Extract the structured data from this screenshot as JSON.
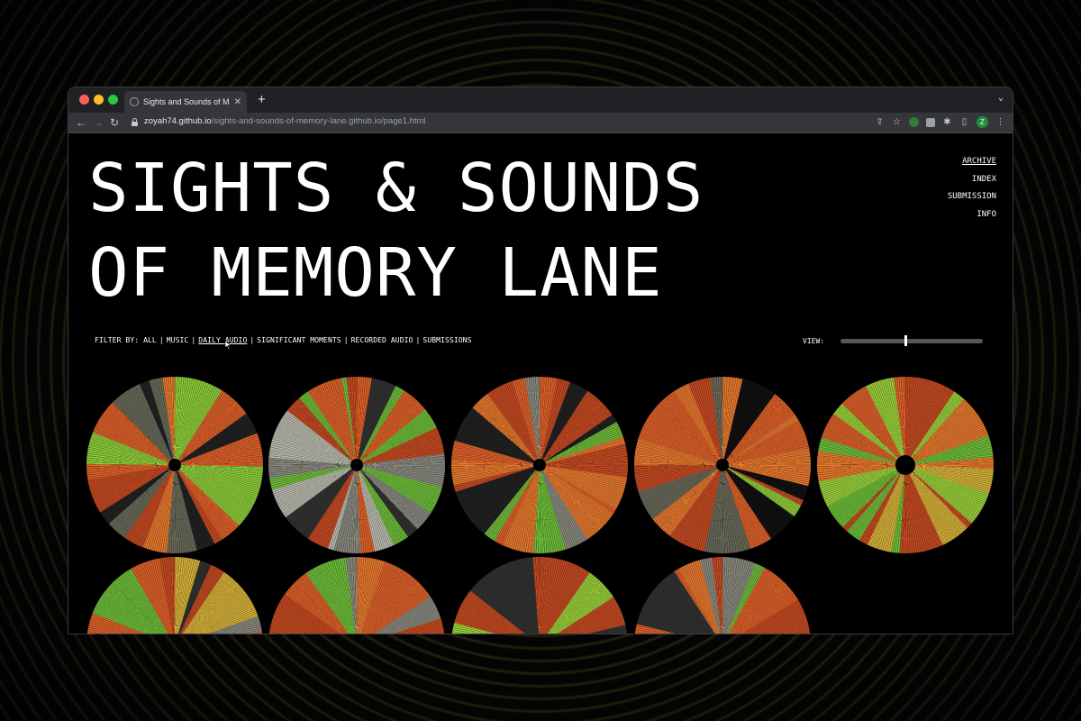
{
  "browser": {
    "tab_title": "Sights and Sounds of Memory Lane",
    "tab_close": "✕",
    "new_tab": "+",
    "tab_menu": "⌄",
    "url_host": "zoyah74.github.io",
    "url_path": "/sights-and-sounds-of-memory-lane.github.io/page1.html",
    "profile_initial": "Z",
    "nav": {
      "back": "←",
      "forward": "→",
      "reload": "↻"
    },
    "icons": {
      "share": "⇪",
      "star": "☆",
      "puzzle": "✱",
      "sidebar": "▯",
      "menu": "⋮"
    }
  },
  "site": {
    "title_line1": "SIGHTS & SOUNDS",
    "title_line2": "OF MEMORY LANE"
  },
  "side_nav": [
    {
      "label": "ARCHIVE",
      "active": true
    },
    {
      "label": "INDEX"
    },
    {
      "label": "SUBMISSION"
    },
    {
      "label": "INFO"
    }
  ],
  "filter": {
    "prefix": "FILTER BY:",
    "separator": "|",
    "items": [
      {
        "label": "ALL"
      },
      {
        "label": "MUSIC"
      },
      {
        "label": "DAILY AUDIO",
        "active": true
      },
      {
        "label": "SIGNIFICANT MOMENTS"
      },
      {
        "label": "RECORDED AUDIO"
      },
      {
        "label": "SUBMISSIONS"
      }
    ]
  },
  "view": {
    "label": "VIEW:",
    "slider_value": 0.45
  },
  "colors": {
    "orange": "#e3662c",
    "red_orange": "#d24a25",
    "green": "#6fbf3a",
    "lime": "#9bd23b",
    "gray": "#6a6a5a",
    "dark": "#1a1a1a",
    "yellow": "#d8b33a"
  },
  "archive_items": [
    {
      "palette": [
        "#e0622a",
        "#c84b22",
        "#8fcf3a",
        "#6a6a5a",
        "#e87a2e",
        "#222"
      ]
    },
    {
      "palette": [
        "#8a8a80",
        "#e0622a",
        "#333",
        "#c84b22",
        "#6fbf3a",
        "#bcbcb0"
      ]
    },
    {
      "palette": [
        "#e0622a",
        "#8a8a80",
        "#222",
        "#c84b22",
        "#6fbf3a",
        "#e87a2e"
      ]
    },
    {
      "palette": [
        "#e0622a",
        "#c84b22",
        "#6a6a5a",
        "#8fcf3a",
        "#111",
        "#e87a2e"
      ]
    },
    {
      "palette": [
        "#e0622a",
        "#9bd23b",
        "#d8b33a",
        "#6fbf3a",
        "#c84b22",
        "#e87a2e"
      ]
    },
    {
      "palette": [
        "#8a8a80",
        "#e0622a",
        "#c84b22",
        "#d8b33a",
        "#6fbf3a",
        "#333"
      ]
    },
    {
      "palette": [
        "#e0622a",
        "#c84b22",
        "#e87a2e",
        "#d8b33a",
        "#6fbf3a",
        "#8a8a80"
      ]
    },
    {
      "palette": [
        "#e0622a",
        "#c84b22",
        "#d8b33a",
        "#e87a2e",
        "#9bd23b",
        "#333"
      ]
    },
    {
      "palette": [
        "#8a8a80",
        "#6fbf3a",
        "#e0622a",
        "#c84b22",
        "#333",
        "#e87a2e"
      ]
    }
  ]
}
